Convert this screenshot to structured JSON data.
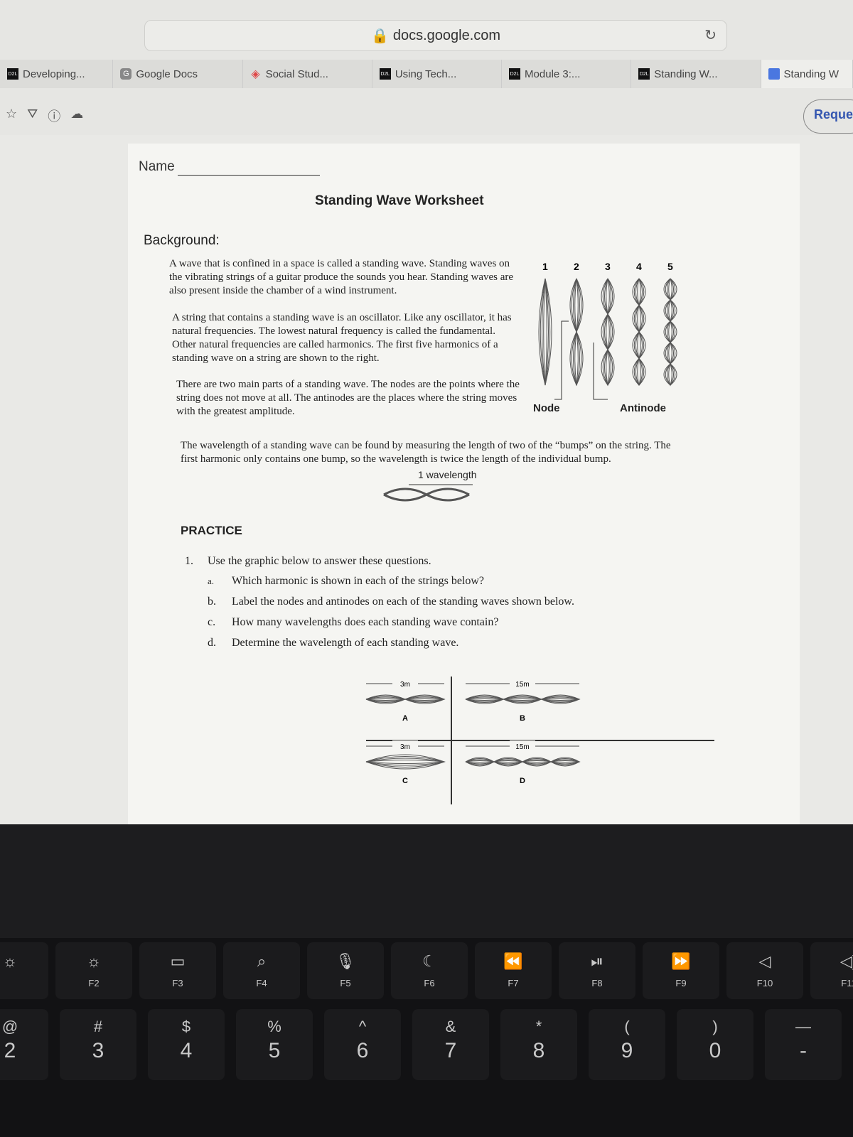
{
  "browser": {
    "url": "docs.google.com",
    "tabs": [
      {
        "label": "Developing...",
        "icon": "d2l-icon"
      },
      {
        "label": "Google Docs",
        "icon": "google-icon"
      },
      {
        "label": "Social Stud...",
        "icon": "schoology-icon"
      },
      {
        "label": "Using Tech...",
        "icon": "d2l-icon"
      },
      {
        "label": "Module 3:...",
        "icon": "d2l-icon"
      },
      {
        "label": "Standing W...",
        "icon": "d2l-icon"
      },
      {
        "label": "Standing W",
        "icon": "docs-icon"
      }
    ],
    "request_button": "Reque"
  },
  "doc": {
    "name_label": "Name",
    "title": "Standing Wave Worksheet",
    "background_heading": "Background:",
    "p1": "A wave that is confined in a space is called a standing wave. Standing waves on the vibrating strings of a guitar produce the sounds you hear. Standing waves are also present inside the chamber of a wind instrument.",
    "p2": "A string that contains a standing wave is an oscillator. Like any oscillator, it has natural frequencies. The lowest natural frequency is called the fundamental. Other natural frequencies are called harmonics. The first five harmonics of a standing wave on a string are shown to the right.",
    "p3": "There are two main parts of a standing wave. The nodes are the points where the string does not move at all. The antinodes are the places where the string moves with the greatest amplitude.",
    "p4": "The wavelength of a standing wave can be found by measuring the length of two of the “bumps” on the string. The first harmonic only contains one bump, so the wavelength is twice the length of the individual bump.",
    "harmonic_labels": [
      "1",
      "2",
      "3",
      "4",
      "5"
    ],
    "node_label": "Node",
    "antinode_label": "Antinode",
    "wavelength_label": "1 wavelength",
    "practice": "PRACTICE",
    "q1_num": "1.",
    "q1": "Use the graphic below to answer these questions.",
    "subs": [
      {
        "l": "a.",
        "t": "Which harmonic is shown in each of the strings below?"
      },
      {
        "l": "b.",
        "t": "Label the nodes and antinodes on each of the standing waves shown below."
      },
      {
        "l": "c.",
        "t": "How many wavelengths does each standing wave contain?"
      },
      {
        "l": "d.",
        "t": "Determine the wavelength of each standing wave."
      }
    ],
    "waves": [
      {
        "id": "A",
        "length": "3m",
        "bumps": 2
      },
      {
        "id": "B",
        "length": "15m",
        "bumps": 3
      },
      {
        "id": "C",
        "length": "3m",
        "bumps": 1
      },
      {
        "id": "D",
        "length": "15m",
        "bumps": 4
      }
    ]
  },
  "keyboard": {
    "fkeys": [
      {
        "icon": "brightness-down-icon",
        "glyph": "☼",
        "label": ""
      },
      {
        "icon": "brightness-up-icon",
        "glyph": "☼",
        "label": "F2"
      },
      {
        "icon": "mission-control-icon",
        "glyph": "▭",
        "label": "F3"
      },
      {
        "icon": "search-icon",
        "glyph": "⌕",
        "label": "F4"
      },
      {
        "icon": "microphone-icon",
        "glyph": "🎙",
        "label": "F5"
      },
      {
        "icon": "moon-icon",
        "glyph": "☾",
        "label": "F6"
      },
      {
        "icon": "rewind-icon",
        "glyph": "⏪",
        "label": "F7"
      },
      {
        "icon": "play-pause-icon",
        "glyph": "⏯",
        "label": "F8"
      },
      {
        "icon": "fast-forward-icon",
        "glyph": "⏩",
        "label": "F9"
      },
      {
        "icon": "mute-icon",
        "glyph": "◁",
        "label": "F10"
      },
      {
        "icon": "volume-up-icon",
        "glyph": "◁)",
        "label": "F11"
      }
    ],
    "numkeys": [
      {
        "s": "@",
        "n": "2"
      },
      {
        "s": "#",
        "n": "3"
      },
      {
        "s": "$",
        "n": "4"
      },
      {
        "s": "%",
        "n": "5"
      },
      {
        "s": "^",
        "n": "6"
      },
      {
        "s": "&",
        "n": "7"
      },
      {
        "s": "*",
        "n": "8"
      },
      {
        "s": "(",
        "n": "9"
      },
      {
        "s": ")",
        "n": "0"
      },
      {
        "s": "—",
        "n": "-"
      }
    ]
  }
}
